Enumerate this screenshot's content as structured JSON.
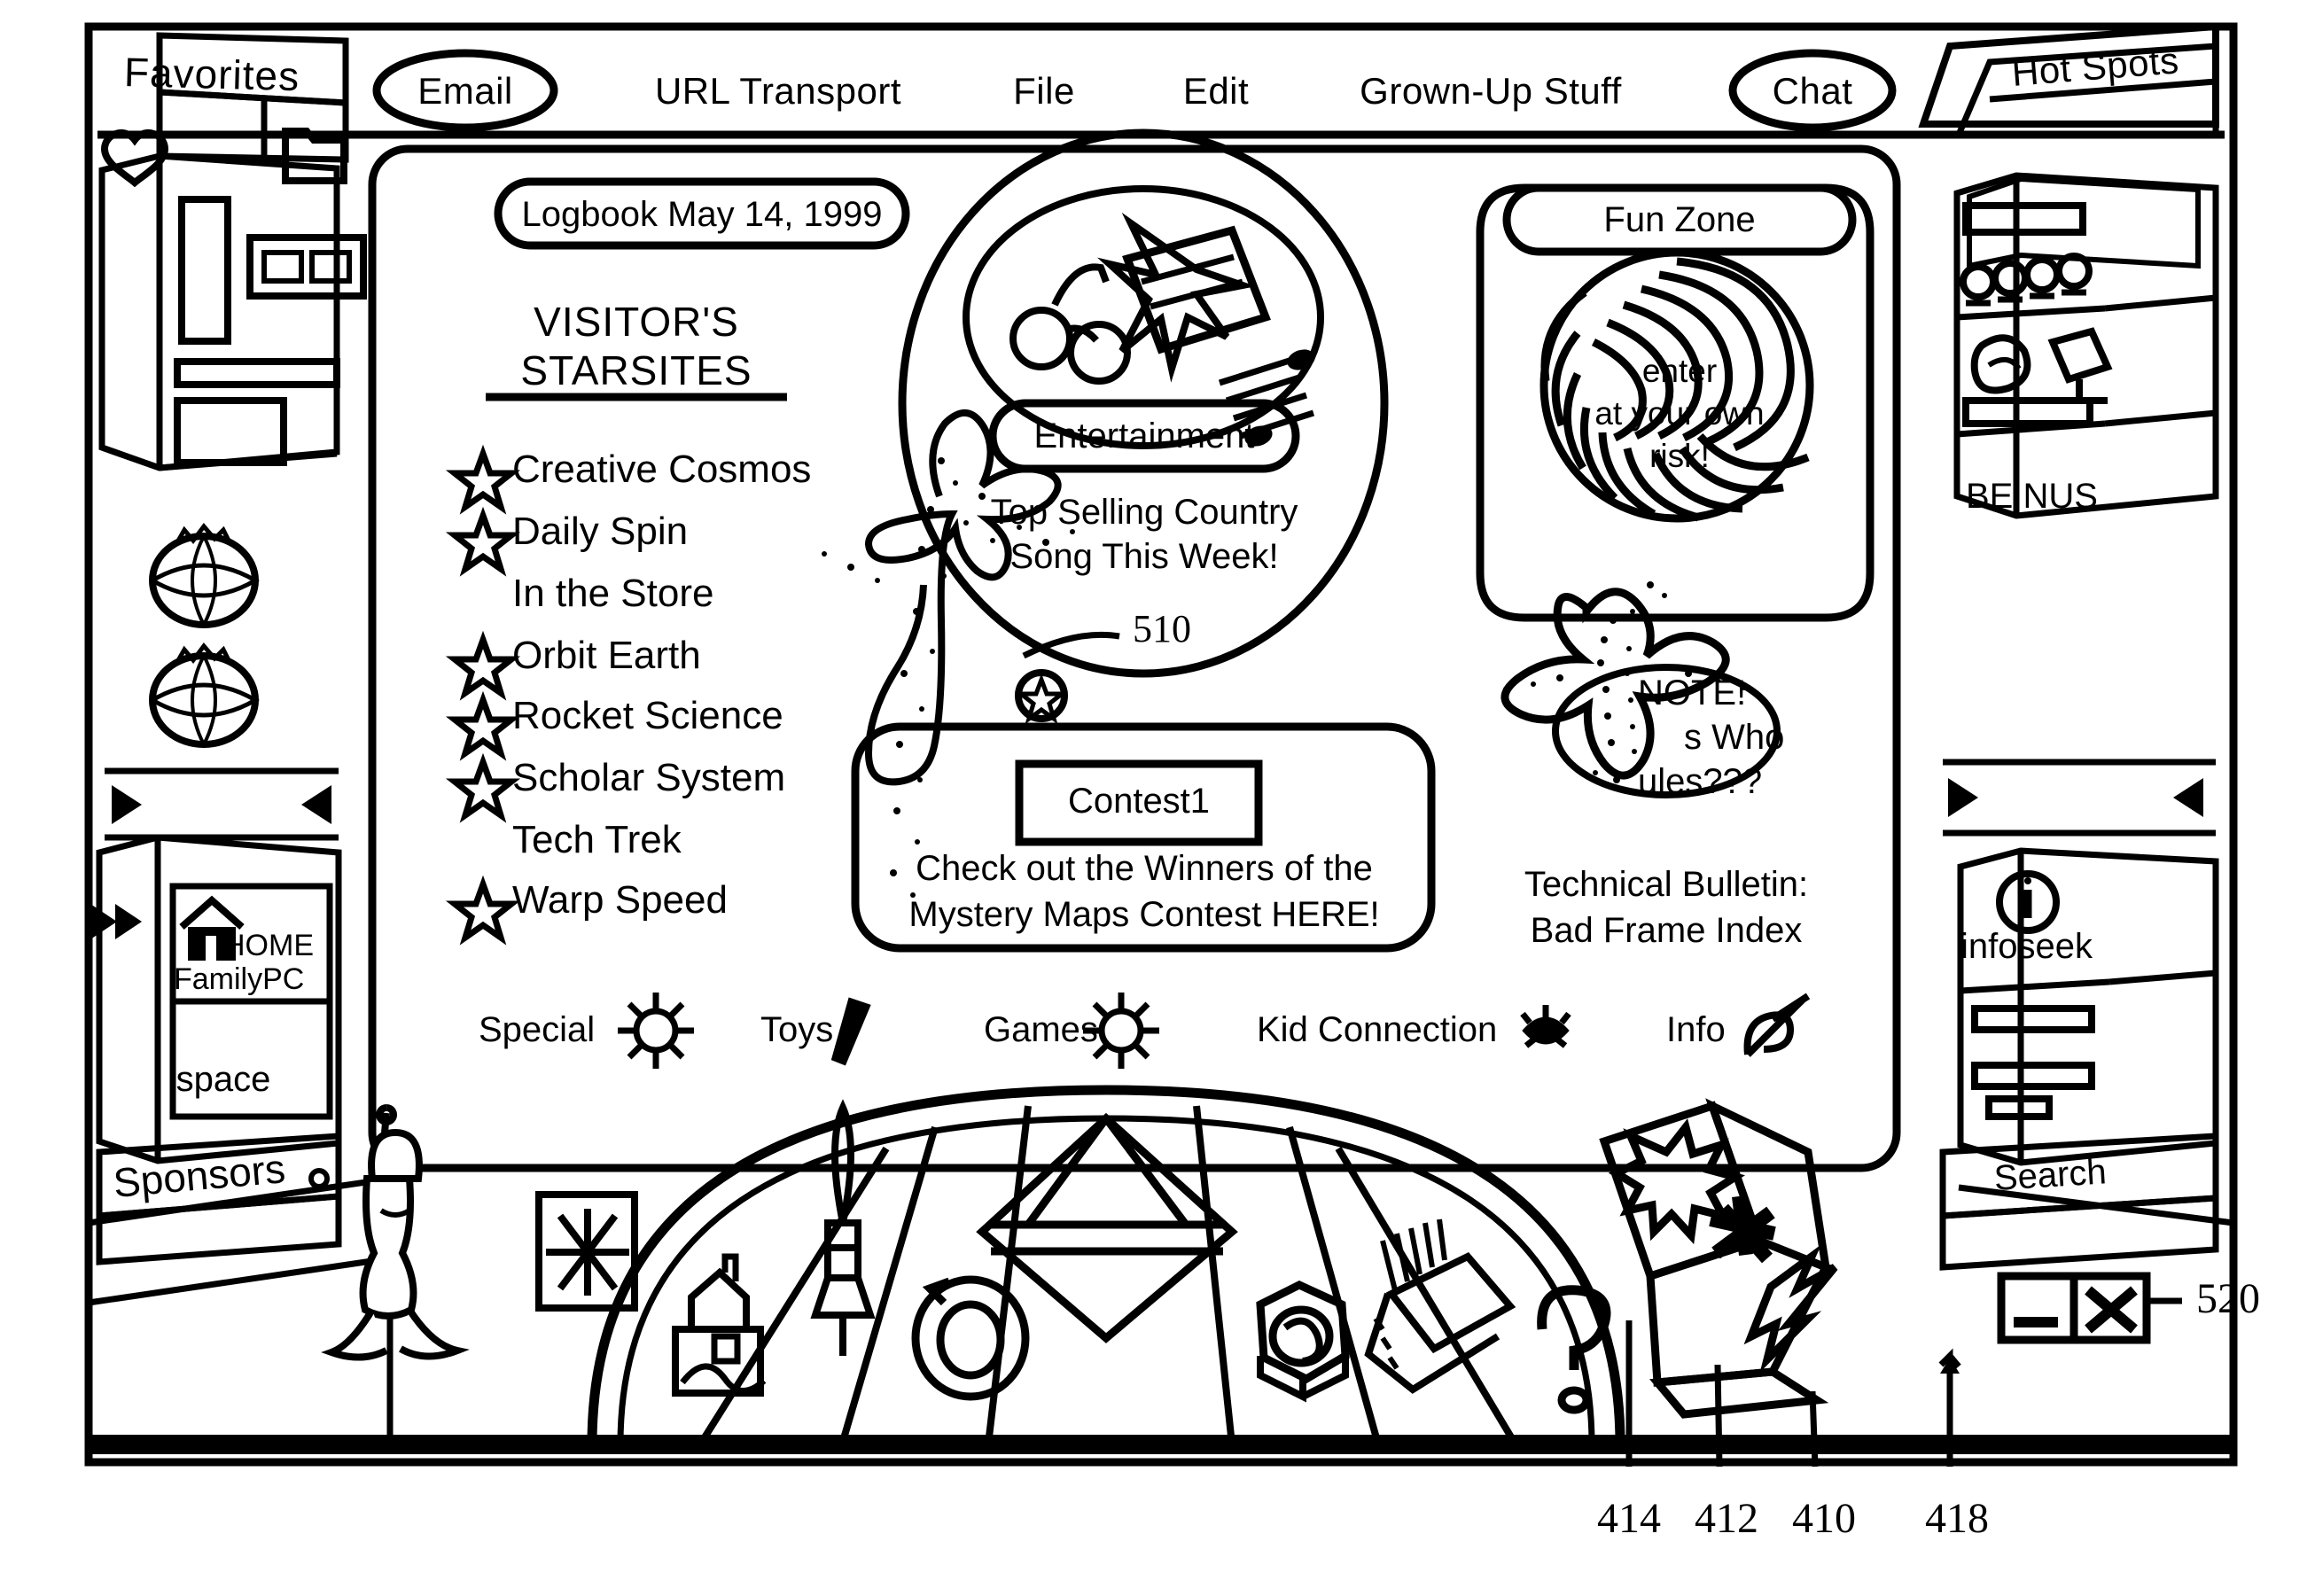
{
  "figure": {
    "reference_numbers": [
      {
        "id": "510",
        "label": "510"
      },
      {
        "id": "520",
        "label": "520"
      },
      {
        "id": "410",
        "label": "410"
      },
      {
        "id": "412",
        "label": "412"
      },
      {
        "id": "414",
        "label": "414"
      },
      {
        "id": "418",
        "label": "418"
      }
    ]
  },
  "menubar": {
    "email_label": "Email",
    "items": [
      {
        "label": "URL Transport"
      },
      {
        "label": "File"
      },
      {
        "label": "Edit"
      },
      {
        "label": "Grown-Up Stuff"
      }
    ],
    "chat_label": "Chat"
  },
  "tabs": {
    "hot_spots_label": "Hot Spots"
  },
  "left_sidebar": {
    "favorites_label": "Favorites",
    "icons": [
      {
        "name": "heart-icon",
        "glyph": "♥"
      },
      {
        "name": "folder-icon",
        "glyph": "🗀"
      }
    ],
    "scroll_left": "◀",
    "scroll_right": "▶",
    "rewind": "◀◀",
    "home_label": "HOME",
    "familypc_label": "FamilyPC",
    "space_label": "space",
    "sponsors_label": "Sponsors"
  },
  "right_sidebar": {
    "be_nus_label": "BE NUS",
    "scroll_left": "◀",
    "scroll_right": "▶",
    "infoseek_label": "infoseek",
    "infoseek_icon": "i",
    "search_label": "Search"
  },
  "content": {
    "logbook_label": "Logbook May 14, 1999",
    "starsites": {
      "title_line1": "VISITOR'S",
      "title_line2": "STARSITES",
      "items": [
        {
          "label": "Creative Cosmos",
          "star": true
        },
        {
          "label": "Daily Spin",
          "star": true
        },
        {
          "label": "In the Store",
          "star": false
        },
        {
          "label": "Orbit Earth",
          "star": true
        },
        {
          "label": "Rocket Science",
          "star": true
        },
        {
          "label": "Scholar System",
          "star": true
        },
        {
          "label": "Tech Trek",
          "star": false
        },
        {
          "label": "Warp Speed",
          "star": true
        }
      ]
    },
    "entertainment": {
      "button_label": "Entertainment",
      "caption_line1": "Top Selling Country",
      "caption_line2": "Song This Week!"
    },
    "contest": {
      "button_label": "Contest1",
      "caption_line1": "Check out the Winners of the",
      "caption_line2": "Mystery Maps Contest HERE!"
    },
    "fun_zone": {
      "title_label": "Fun Zone",
      "ball_line1": "enter",
      "ball_line2": "at your own",
      "ball_line3": "risk!",
      "note_line1": "NOTE!",
      "note_line2": "s Who",
      "note_line3": "ules???",
      "bulletin_line1": "Technical Bulletin:",
      "bulletin_line2": "Bad Frame Index"
    },
    "category_links": [
      {
        "label": "Special",
        "icon": "sun-burst-icon"
      },
      {
        "label": "Toys",
        "icon": "pencil-icon"
      },
      {
        "label": "Games",
        "icon": "sun-burst-icon"
      },
      {
        "label": "Kid Connection",
        "icon": "eye-icon"
      },
      {
        "label": "Info",
        "icon": "swoosh-icon"
      }
    ]
  },
  "taskbar": {
    "wedges": [
      {
        "icon": "house-landscape-icon"
      },
      {
        "icon": "rocket-icon"
      },
      {
        "icon": "diamond-icon"
      },
      {
        "icon": "circular-arrow-icon"
      },
      {
        "icon": "hex-nut-icon"
      },
      {
        "icon": "book-icon"
      },
      {
        "icon": "question-mark-icon"
      },
      {
        "icon": "starburst-icon"
      },
      {
        "icon": "asterisk-icon"
      },
      {
        "icon": "lightning-icon"
      }
    ],
    "tray_icon": "pinwheel-icon"
  },
  "window_controls": {
    "minimize": "minimize-icon",
    "close": "close-icon"
  }
}
